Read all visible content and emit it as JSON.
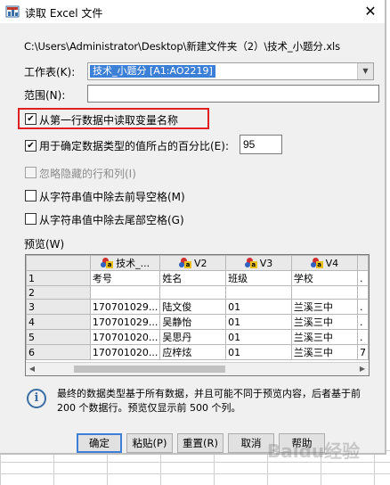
{
  "window": {
    "title": "读取 Excel 文件",
    "close": "✕"
  },
  "file_path": "C:\\Users\\Administrator\\Desktop\\新建文件夹（2）\\技术_小题分.xls",
  "worksheet": {
    "label": "工作表(K):",
    "value": "技术_小题分 [A1:AO2219]"
  },
  "range": {
    "label": "范围(N):",
    "value": ""
  },
  "options": {
    "read_var_names": {
      "label": "从第一行数据中读取变量名称",
      "checked": "✔"
    },
    "percent": {
      "label": "用于确定数据类型的值所占的百分比(E):",
      "checked": "✔",
      "value": "95"
    },
    "ignore_hidden": {
      "label": "忽略隐藏的行和列(I)",
      "checked": ""
    },
    "trim_leading": {
      "label": "从字符串值中除去前导空格(M)",
      "checked": ""
    },
    "trim_trailing": {
      "label": "从字符串值中除去尾部空格(G)",
      "checked": ""
    }
  },
  "preview": {
    "label": "预览(W)",
    "columns": [
      "技术_...",
      "V2",
      "V3",
      "V4"
    ],
    "rows": [
      {
        "n": "1",
        "cells": [
          "考号",
          "姓名",
          "班级",
          "学校"
        ],
        "last": "."
      },
      {
        "n": "2",
        "cells": [
          "",
          "",
          "",
          ""
        ],
        "last": ""
      },
      {
        "n": "3",
        "cells": [
          "170701029...",
          "陆文俊",
          "01",
          "兰溪三中"
        ],
        "last": "."
      },
      {
        "n": "4",
        "cells": [
          "170701029...",
          "吴静怡",
          "01",
          "兰溪三中"
        ],
        "last": "."
      },
      {
        "n": "5",
        "cells": [
          "170701020...",
          "吴思丹",
          "01",
          "兰溪三中"
        ],
        "last": "."
      },
      {
        "n": "6",
        "cells": [
          "170701020...",
          "应梓炫",
          "01",
          "兰溪三中"
        ],
        "last": "7"
      }
    ]
  },
  "info": "最终的数据类型基于所有数据，并且可能不同于预览内容，后者基于前 200 个数据行。预览仅显示前 500 个列。",
  "buttons": {
    "ok": "确定",
    "paste": "粘贴(P)",
    "reset": "重置(R)",
    "cancel": "取消",
    "help": "帮助"
  },
  "watermark": "Baidu经验"
}
